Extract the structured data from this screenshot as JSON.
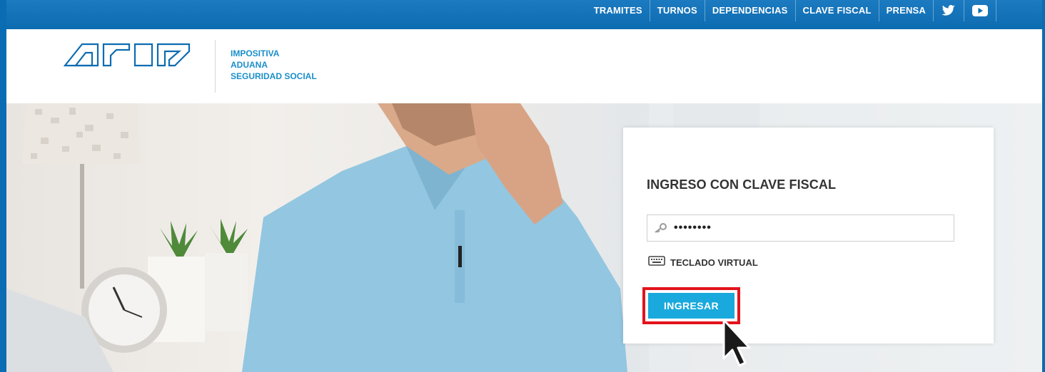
{
  "topnav": {
    "items": [
      "TRAMITES",
      "TURNOS",
      "DEPENDENCIAS",
      "CLAVE FISCAL",
      "PRENSA"
    ],
    "icons": [
      "twitter-icon",
      "youtube-icon"
    ]
  },
  "header": {
    "tagline": [
      "IMPOSITIVA",
      "ADUANA",
      "SEGURIDAD SOCIAL"
    ]
  },
  "login": {
    "title": "INGRESO CON CLAVE FISCAL",
    "password_value": "••••••••",
    "virtual_keyboard_label": "TECLADO VIRTUAL",
    "submit_label": "INGRESAR"
  },
  "colors": {
    "brand_blue": "#0d6cb1",
    "tagline_blue": "#1a8fca",
    "button_blue": "#19a9dd",
    "highlight_red": "#e2131c"
  }
}
